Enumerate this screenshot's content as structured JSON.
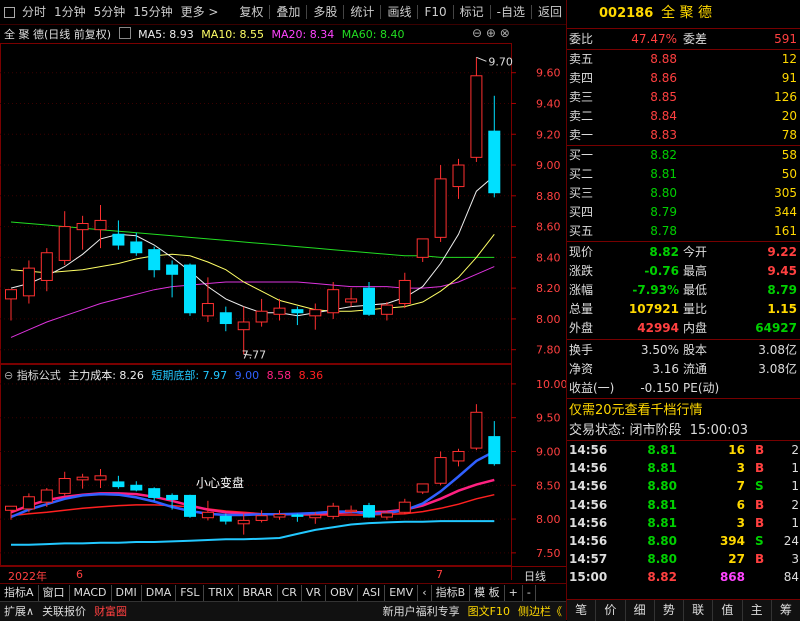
{
  "toolbar": {
    "tabs": [
      "分时",
      "1分钟",
      "5分钟",
      "15分钟",
      "更多 >",
      "复权",
      "叠加",
      "多股",
      "统计",
      "画线",
      "F10",
      "标记",
      "-自选",
      "返回"
    ]
  },
  "chart_header": {
    "title": "全 聚 德(日线 前复权)",
    "ma5": "MA5: 8.93",
    "ma10": "MA10: 8.55",
    "ma20": "MA20: 8.34",
    "ma60": "MA60: 8.40"
  },
  "main_axis": {
    "labels": [
      "9.60",
      "9.40",
      "9.20",
      "9.00",
      "8.80",
      "8.60",
      "8.40",
      "8.20",
      "8.00",
      "7.80"
    ],
    "high_mark": "9.70",
    "low_mark": "7.77"
  },
  "indicator_header": {
    "name": "指标公式",
    "main_cost": "主力成本: 8.26",
    "short_bottom": "短期底部: 7.97",
    "v1": "9.00",
    "v2": "8.58",
    "v3": "8.36"
  },
  "indicator_axis": {
    "labels": [
      "10.00",
      "9.50",
      "9.00",
      "8.50",
      "8.00",
      "7.50"
    ]
  },
  "annotation": "小心变盘",
  "date_axis": {
    "year": "2022年",
    "m1": "6",
    "m2": "7",
    "period": "日线"
  },
  "bottom_tabs": [
    "指标A",
    "窗口",
    "MACD",
    "DMI",
    "DMA",
    "FSL",
    "TRIX",
    "BRAR",
    "CR",
    "VR",
    "OBV",
    "ASI",
    "EMV",
    "‹",
    "指标B",
    "模 板",
    "+",
    "-"
  ],
  "bottom_bar2": {
    "left": [
      "扩展∧",
      "关联报价",
      "财富圈"
    ],
    "right": [
      "新用户福利专享",
      "图文F10",
      "侧边栏《"
    ]
  },
  "panel": {
    "code": "002186",
    "name": "全 聚 德",
    "weibi_label": "委比",
    "weibi": "47.47%",
    "weicha_label": "委差",
    "weicha": "591",
    "asks": [
      {
        "label": "卖五",
        "price": "8.88",
        "vol": "12"
      },
      {
        "label": "卖四",
        "price": "8.86",
        "vol": "91"
      },
      {
        "label": "卖三",
        "price": "8.85",
        "vol": "126"
      },
      {
        "label": "卖二",
        "price": "8.84",
        "vol": "20"
      },
      {
        "label": "卖一",
        "price": "8.83",
        "vol": "78"
      }
    ],
    "bids": [
      {
        "label": "买一",
        "price": "8.82",
        "vol": "58"
      },
      {
        "label": "买二",
        "price": "8.81",
        "vol": "50"
      },
      {
        "label": "买三",
        "price": "8.80",
        "vol": "305"
      },
      {
        "label": "买四",
        "price": "8.79",
        "vol": "344"
      },
      {
        "label": "买五",
        "price": "8.78",
        "vol": "161"
      }
    ],
    "stats": [
      {
        "l1": "现价",
        "v1": "8.82",
        "l2": "今开",
        "v2": "9.22"
      },
      {
        "l1": "涨跌",
        "v1": "-0.76",
        "l2": "最高",
        "v2": "9.45"
      },
      {
        "l1": "涨幅",
        "v1": "-7.93%",
        "l2": "最低",
        "v2": "8.79"
      },
      {
        "l1": "总量",
        "v1": "107921",
        "l2": "量比",
        "v2": "1.15"
      },
      {
        "l1": "外盘",
        "v1": "42994",
        "l2": "内盘",
        "v2": "64927"
      }
    ],
    "stats2": [
      {
        "l1": "换手",
        "v1": "3.50%",
        "l2": "股本",
        "v2": "3.08亿"
      },
      {
        "l1": "净资",
        "v1": "3.16",
        "l2": "流通",
        "v2": "3.08亿"
      },
      {
        "l1": "收益(一)",
        "v1": "-0.150",
        "l2": "PE(动)",
        "v2": ""
      }
    ],
    "promo": "仅需20元查看千档行情",
    "status_label": "交易状态:",
    "status_value": "闭市阶段",
    "status_time": "15:00:03",
    "ticks": [
      {
        "t": "14:56",
        "p": "8.81",
        "v": "16",
        "d": "B",
        "n": "2"
      },
      {
        "t": "14:56",
        "p": "8.81",
        "v": "3",
        "d": "B",
        "n": "1"
      },
      {
        "t": "14:56",
        "p": "8.80",
        "v": "7",
        "d": "S",
        "n": "1"
      },
      {
        "t": "14:56",
        "p": "8.81",
        "v": "6",
        "d": "B",
        "n": "2"
      },
      {
        "t": "14:56",
        "p": "8.81",
        "v": "3",
        "d": "B",
        "n": "1"
      },
      {
        "t": "14:56",
        "p": "8.80",
        "v": "394",
        "d": "S",
        "n": "24"
      },
      {
        "t": "14:57",
        "p": "8.80",
        "v": "27",
        "d": "B",
        "n": "3"
      },
      {
        "t": "15:00",
        "p": "8.82",
        "v": "868",
        "d": "",
        "n": "84"
      }
    ],
    "bottom_tabs": [
      "笔",
      "价",
      "细",
      "势",
      "联",
      "值",
      "主",
      "筹"
    ]
  },
  "chart_data": {
    "type": "candlestick",
    "candles": [
      {
        "o": 8.13,
        "c": 8.19,
        "h": 8.19,
        "l": 7.99
      },
      {
        "o": 8.15,
        "c": 8.33,
        "h": 8.38,
        "l": 8.1
      },
      {
        "o": 8.25,
        "c": 8.43,
        "h": 8.46,
        "l": 8.18
      },
      {
        "o": 8.38,
        "c": 8.6,
        "h": 8.7,
        "l": 8.35
      },
      {
        "o": 8.58,
        "c": 8.62,
        "h": 8.67,
        "l": 8.45
      },
      {
        "o": 8.58,
        "c": 8.64,
        "h": 8.74,
        "l": 8.46
      },
      {
        "o": 8.55,
        "c": 8.48,
        "h": 8.64,
        "l": 8.45
      },
      {
        "o": 8.5,
        "c": 8.43,
        "h": 8.56,
        "l": 8.41
      },
      {
        "o": 8.45,
        "c": 8.32,
        "h": 8.47,
        "l": 8.27
      },
      {
        "o": 8.35,
        "c": 8.29,
        "h": 8.38,
        "l": 8.14
      },
      {
        "o": 8.35,
        "c": 8.04,
        "h": 8.36,
        "l": 8.02
      },
      {
        "o": 8.02,
        "c": 8.1,
        "h": 8.27,
        "l": 7.98
      },
      {
        "o": 8.04,
        "c": 7.97,
        "h": 8.08,
        "l": 7.92
      },
      {
        "o": 7.93,
        "c": 7.98,
        "h": 8.08,
        "l": 7.77
      },
      {
        "o": 7.98,
        "c": 8.05,
        "h": 8.13,
        "l": 7.95
      },
      {
        "o": 8.03,
        "c": 8.07,
        "h": 8.13,
        "l": 7.99
      },
      {
        "o": 8.06,
        "c": 8.04,
        "h": 8.08,
        "l": 7.96
      },
      {
        "o": 8.02,
        "c": 8.06,
        "h": 8.1,
        "l": 7.93
      },
      {
        "o": 8.04,
        "c": 8.19,
        "h": 8.24,
        "l": 8.0
      },
      {
        "o": 8.11,
        "c": 8.13,
        "h": 8.2,
        "l": 8.08
      },
      {
        "o": 8.2,
        "c": 8.03,
        "h": 8.24,
        "l": 8.02
      },
      {
        "o": 8.03,
        "c": 8.09,
        "h": 8.11,
        "l": 7.99
      },
      {
        "o": 8.1,
        "c": 8.25,
        "h": 8.3,
        "l": 8.07
      },
      {
        "o": 8.4,
        "c": 8.52,
        "h": 8.52,
        "l": 8.37
      },
      {
        "o": 8.53,
        "c": 8.91,
        "h": 9.0,
        "l": 8.5
      },
      {
        "o": 8.86,
        "c": 9.0,
        "h": 9.04,
        "l": 8.78
      },
      {
        "o": 9.05,
        "c": 9.58,
        "h": 9.7,
        "l": 9.02
      },
      {
        "o": 9.22,
        "c": 8.82,
        "h": 9.45,
        "l": 8.79
      }
    ],
    "ma5": [
      8.2,
      8.23,
      8.28,
      8.34,
      8.42,
      8.52,
      8.55,
      8.54,
      8.48,
      8.4,
      8.31,
      8.21,
      8.13,
      8.08,
      8.04,
      8.04,
      8.02,
      8.04,
      8.06,
      8.08,
      8.09,
      8.1,
      8.14,
      8.21,
      8.36,
      8.55,
      8.83,
      8.93
    ],
    "ma10": [
      8.32,
      8.31,
      8.3,
      8.31,
      8.32,
      8.34,
      8.36,
      8.39,
      8.41,
      8.42,
      8.41,
      8.37,
      8.32,
      8.24,
      8.18,
      8.12,
      8.09,
      8.06,
      8.05,
      8.05,
      8.06,
      8.07,
      8.08,
      8.11,
      8.18,
      8.27,
      8.4,
      8.55
    ],
    "ma20": [
      7.88,
      7.93,
      7.98,
      8.02,
      8.06,
      8.1,
      8.13,
      8.16,
      8.19,
      8.21,
      8.22,
      8.23,
      8.24,
      8.24,
      8.24,
      8.24,
      8.24,
      8.23,
      8.22,
      8.21,
      8.21,
      8.21,
      8.2,
      8.2,
      8.21,
      8.24,
      8.29,
      8.34
    ],
    "ma60": [
      8.63,
      8.62,
      8.61,
      8.6,
      8.59,
      8.58,
      8.57,
      8.56,
      8.55,
      8.54,
      8.53,
      8.52,
      8.51,
      8.5,
      8.49,
      8.48,
      8.47,
      8.46,
      8.45,
      8.44,
      8.43,
      8.42,
      8.41,
      8.41,
      8.4,
      8.4,
      8.4,
      8.4
    ],
    "main_ylim": [
      7.72,
      9.78
    ],
    "ind_main_cost": [
      8.03,
      8.14,
      8.22,
      8.3,
      8.35,
      8.37,
      8.36,
      8.32,
      8.26,
      8.18,
      8.12,
      8.08,
      8.06,
      8.06,
      8.07,
      8.07,
      8.08,
      8.09,
      8.11,
      8.11,
      8.08,
      8.09,
      8.13,
      8.23,
      8.41,
      8.63,
      8.86,
      9.0
    ],
    "ind_short_bottom": [
      7.62,
      7.62,
      7.63,
      7.64,
      7.64,
      7.65,
      7.65,
      7.66,
      7.66,
      7.67,
      7.68,
      7.69,
      7.7,
      7.7,
      7.71,
      7.72,
      7.78,
      7.84,
      7.88,
      7.92,
      7.94,
      7.95,
      7.96,
      7.96,
      7.97,
      7.97,
      7.97,
      7.97
    ],
    "ind_line3": [
      8.1,
      8.2,
      8.28,
      8.33,
      8.36,
      8.38,
      8.38,
      8.37,
      8.33,
      8.27,
      8.2,
      8.14,
      8.1,
      8.08,
      8.07,
      8.07,
      8.07,
      8.08,
      8.09,
      8.1,
      8.1,
      8.11,
      8.14,
      8.2,
      8.3,
      8.42,
      8.51,
      8.58
    ],
    "ind_line4": [
      8.05,
      8.08,
      8.1,
      8.13,
      8.16,
      8.18,
      8.2,
      8.21,
      8.21,
      8.2,
      8.18,
      8.15,
      8.12,
      8.1,
      8.08,
      8.07,
      8.06,
      8.06,
      8.06,
      8.06,
      8.06,
      8.07,
      8.08,
      8.11,
      8.16,
      8.22,
      8.3,
      8.36
    ],
    "ind_ylim": [
      7.35,
      10.25
    ]
  }
}
